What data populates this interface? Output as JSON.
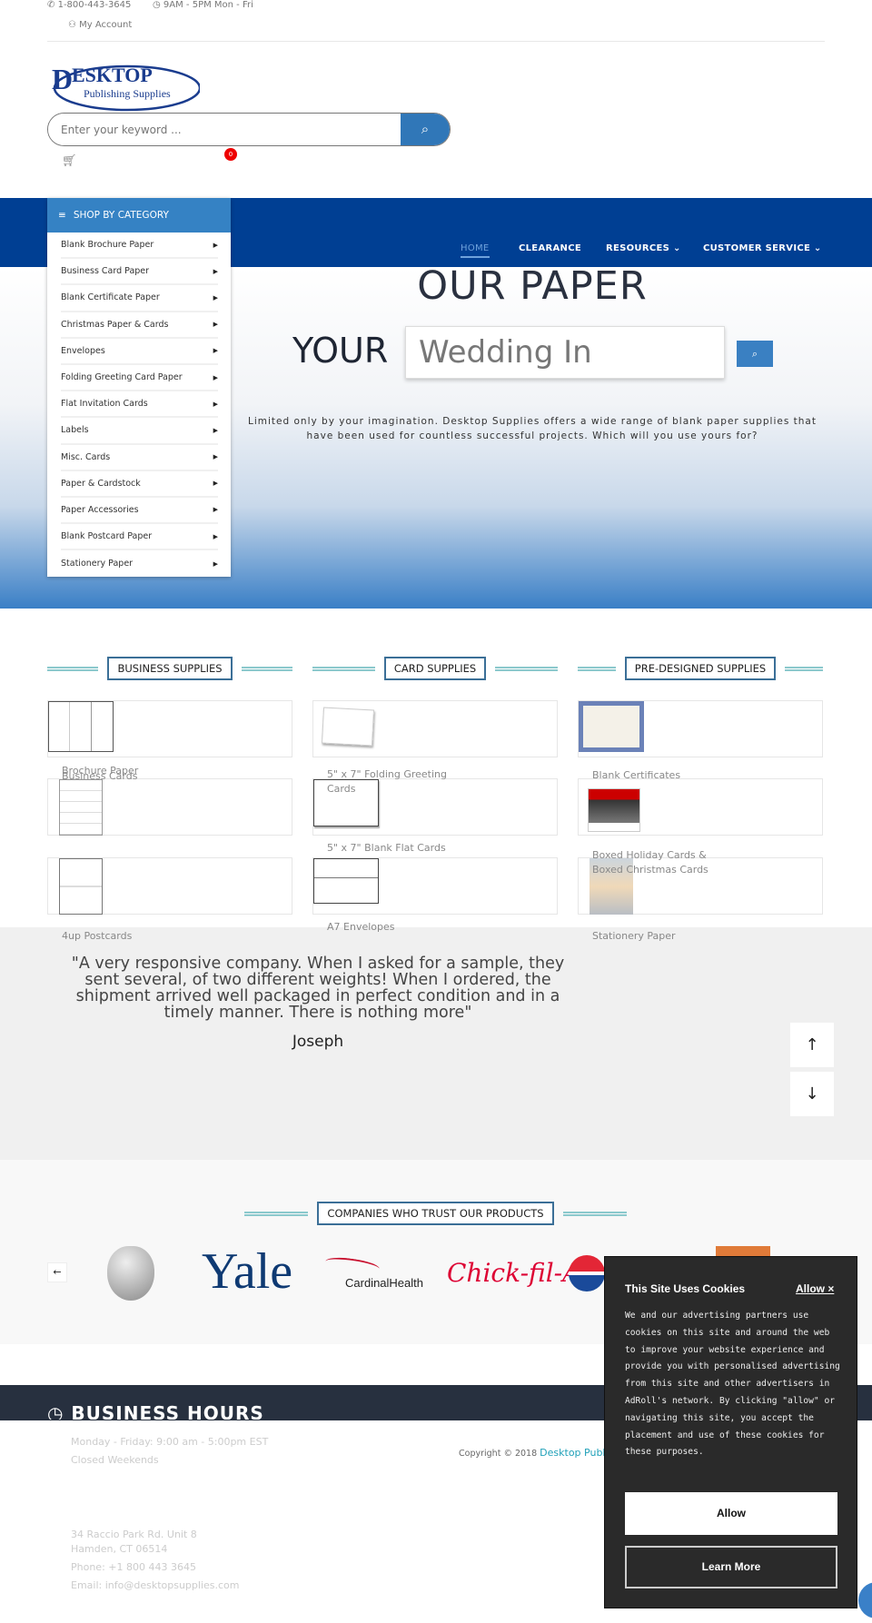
{
  "topbar": {
    "phone": "1-800-443-3645",
    "hours": "9AM - 5PM Mon - Fri",
    "account": "My Account"
  },
  "logo": {
    "line1": "DESKTOP",
    "line2": "Publishing Supplies"
  },
  "search": {
    "placeholder": "Enter your keyword ..."
  },
  "cart": {
    "count": "0"
  },
  "category_menu": {
    "title": "SHOP BY CATEGORY",
    "items": [
      "Blank Brochure Paper",
      "Business Card Paper",
      "Blank Certificate Paper",
      "Christmas Paper & Cards",
      "Envelopes",
      "Folding Greeting Card Paper",
      "Flat Invitation Cards",
      "Labels",
      "Misc. Cards",
      "Paper & Cardstock",
      "Paper Accessories",
      "Blank Postcard Paper",
      "Stationery Paper"
    ]
  },
  "nav": {
    "home": "HOME",
    "clearance": "CLEARANCE",
    "resources": "RESOURCES",
    "customer_service": "CUSTOMER SERVICE"
  },
  "hero": {
    "heading": "OUR PAPER",
    "your": "YOUR",
    "typed": "Wedding In",
    "description": "Limited only by your imagination. Desktop Supplies offers a wide range of blank paper supplies that have been used for countless successful projects. Which will you use yours for?"
  },
  "sections": [
    {
      "title": "BUSINESS SUPPLIES",
      "items": [
        "Brochure Paper",
        "Business Cards",
        "4up Postcards"
      ]
    },
    {
      "title": "CARD SUPPLIES",
      "items": [
        "5\" x 7\" Folding Greeting Cards",
        "5\" x 7\" Blank Flat Cards",
        "A7 Envelopes"
      ]
    },
    {
      "title": "PRE-DESIGNED SUPPLIES",
      "items": [
        "Blank Certificates",
        "Boxed Holiday Cards & Boxed Christmas Cards",
        "Stationery Paper"
      ]
    }
  ],
  "testimonial": {
    "quote": "\"A very responsive company. When I asked for a sample, they sent several, of two different weights! When I ordered, the shipment arrived well packaged in perfect condition and in a timely manner. There is nothing more\"",
    "author": "Joseph",
    "up": "↑",
    "down": "↓"
  },
  "companies": {
    "title": "COMPANIES WHO TRUST OUR PRODUCTS",
    "prev": "←",
    "logos": [
      "Apple",
      "Yale",
      "CardinalHealth",
      "Chick-fil-A",
      "pepsi"
    ]
  },
  "footer": {
    "heading": "BUSINESS HOURS",
    "hours1": "Monday - Friday: 9:00 am - 5:00pm EST",
    "hours2": "Closed Weekends",
    "address1": "34 Raccio Park Rd. Unit 8",
    "address2": "Hamden, CT 06514",
    "phone": "Phone: +1 800 443 3645",
    "email": "Email: info@desktopsupplies.com",
    "copyright": "Copyright © 2018",
    "copyright_link": "Desktop Publ"
  },
  "cookie": {
    "title": "This Site Uses Cookies",
    "close": "Allow ×",
    "body": "We and our advertising partners use cookies on this site and around the web to improve your website experience and provide you with personalised advertising from this site and other advertisers in AdRoll's network. By clicking \"allow\" or navigating this site, you accept the placement and use of these cookies for these purposes.",
    "allow": "Allow",
    "learn_more": "Learn More"
  },
  "colors": {
    "nav_blue": "#003f93",
    "accent_blue": "#3582c4",
    "footer_dark": "#27303f",
    "teal": "#8cc9cd"
  }
}
